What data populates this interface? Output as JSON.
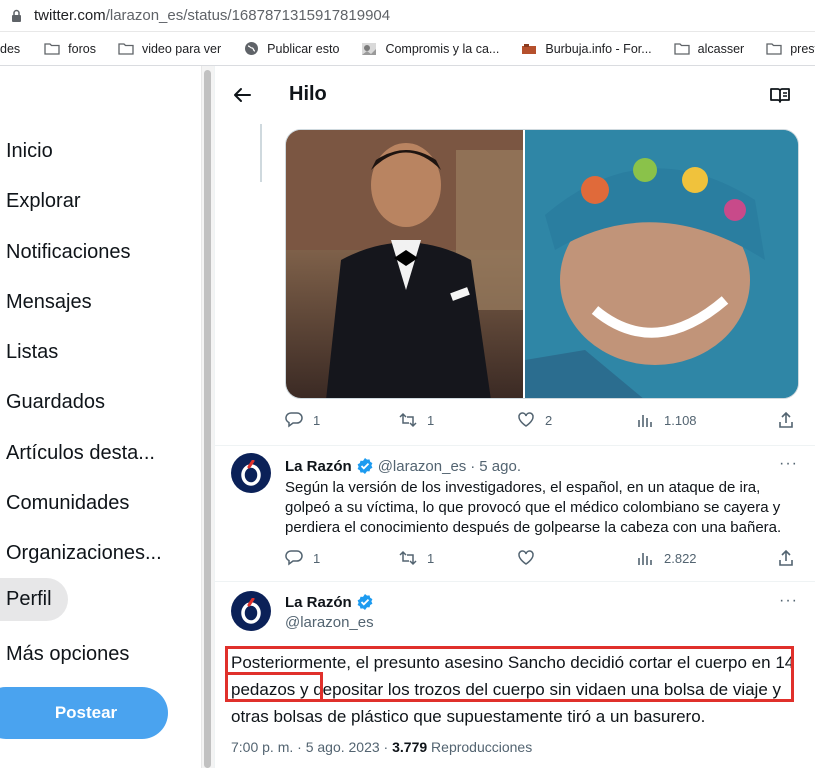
{
  "browser": {
    "url_host": "twitter.com",
    "url_path": "/larazon_es/status/1687871315917819904",
    "bookmarks": [
      {
        "label": "des",
        "icon": "none"
      },
      {
        "label": "foros",
        "icon": "folder-icon"
      },
      {
        "label": "video para ver",
        "icon": "folder-icon"
      },
      {
        "label": "Publicar esto",
        "icon": "globe-icon"
      },
      {
        "label": "Compromis y la ca...",
        "icon": "image-icon"
      },
      {
        "label": "Burbuja.info - For...",
        "icon": "brick-icon"
      },
      {
        "label": "alcasser",
        "icon": "folder-icon"
      },
      {
        "label": "prestige",
        "icon": "folder-icon"
      }
    ]
  },
  "nav": {
    "items": [
      "Inicio",
      "Explorar",
      "Notificaciones",
      "Mensajes",
      "Listas",
      "Guardados",
      "Artículos desta...",
      "Comunidades",
      "Organizaciones...",
      "Perfil",
      "Más opciones"
    ],
    "active": "Perfil",
    "post_button": "Postear"
  },
  "header": {
    "title": "Hilo"
  },
  "tweet1_actions": {
    "replies": "1",
    "retweets": "1",
    "likes": "2",
    "views": "1.108"
  },
  "tweet2": {
    "name": "La Razón",
    "handle": "@larazon_es",
    "time": "5 ago.",
    "text": "Según la versión de los investigadores, el español, en un ataque de ira, golpeó a su víctima, lo que provocó que el médico colombiano se cayera y perdiera el conocimiento después de golpearse la cabeza con una bañera.",
    "replies": "1",
    "retweets": "1",
    "likes": "",
    "views": "2.822"
  },
  "tweet3": {
    "name": "La Razón",
    "handle": "@larazon_es",
    "text_before": "Posteriormente, el presunto asesino Sancho decidió cortar el cuerpo en ",
    "text_highlight": "14 pedazos",
    "text_after": " y depositar los trozos del cuerpo sin vidaen una bolsa de viaje y otras bolsas de plástico que supuestamente tiró a un basurero.",
    "time": "7:00 p. m. · 5 ago. 2023 · ",
    "views_count": "3.779",
    "views_label": " Reproducciones"
  },
  "colors": {
    "accent": "#1d9bf0",
    "post_button": "#4aa3ef",
    "highlight_box": "#e0302b",
    "avatar_bg": "#0b2158"
  }
}
